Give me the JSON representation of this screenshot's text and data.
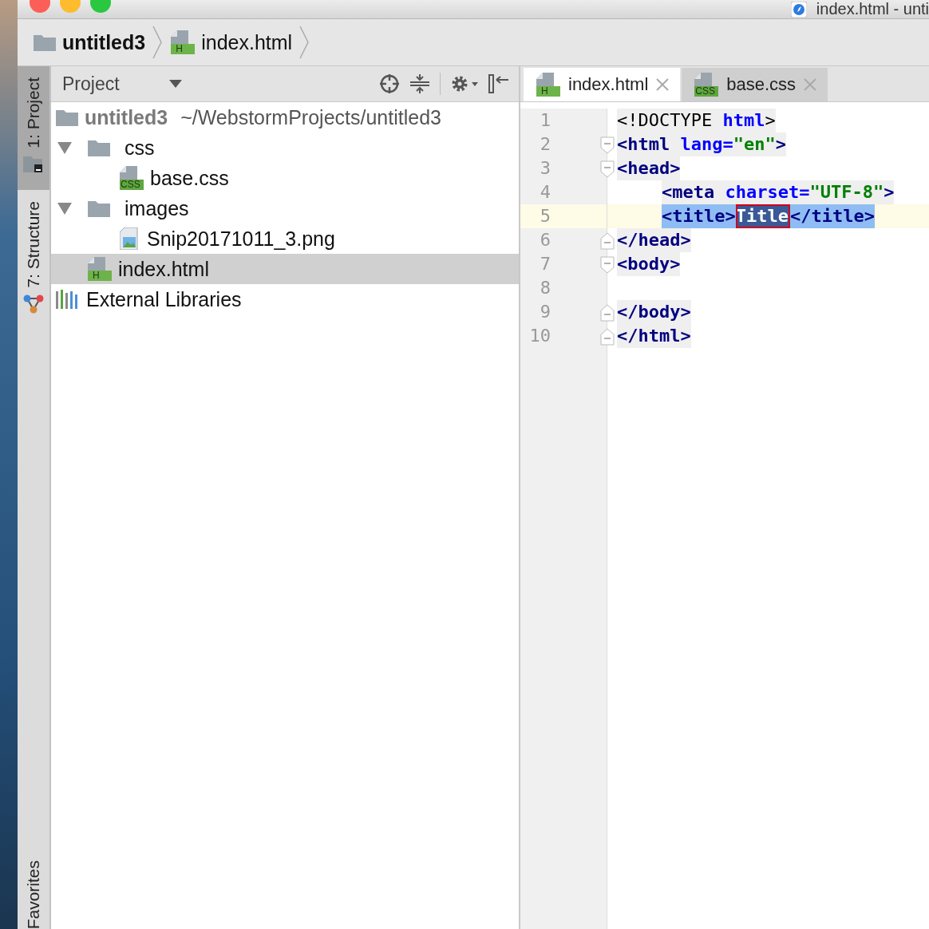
{
  "window": {
    "title": "index.html - unti"
  },
  "breadcrumbs": [
    {
      "label": "untitled3",
      "kind": "folder"
    },
    {
      "label": "index.html",
      "kind": "html",
      "badge": "H"
    }
  ],
  "tool_strip": [
    {
      "label": "1: Project",
      "kind": "project",
      "selected": true
    },
    {
      "label": "7: Structure",
      "kind": "structure",
      "selected": false
    },
    {
      "label": "Favorites",
      "kind": "favorites",
      "selected": false
    }
  ],
  "project_panel": {
    "title": "Project",
    "tree": [
      {
        "label": "untitled3",
        "path": "~/WebstormProjects/untitled3",
        "kind": "root",
        "selected": false,
        "children": [
          {
            "label": "css",
            "kind": "folder",
            "expanded": true,
            "selected": false,
            "children": [
              {
                "label": "base.css",
                "kind": "css",
                "badge": "CSS",
                "selected": false
              }
            ]
          },
          {
            "label": "images",
            "kind": "folder",
            "expanded": true,
            "selected": false,
            "children": [
              {
                "label": "Snip20171011_3.png",
                "kind": "image",
                "selected": false
              }
            ]
          },
          {
            "label": "index.html",
            "kind": "html",
            "badge": "H",
            "selected": true
          }
        ]
      },
      {
        "label": "External Libraries",
        "kind": "library",
        "selected": false
      }
    ]
  },
  "editor": {
    "tabs": [
      {
        "label": "index.html",
        "kind": "html",
        "badge": "H",
        "selected": true
      },
      {
        "label": "base.css",
        "kind": "css",
        "badge": "CSS",
        "selected": false
      }
    ],
    "lines": [
      {
        "number": "1",
        "current": false,
        "indented": false,
        "selected": false,
        "fold_start": false,
        "fold_end": false,
        "tokens": [
          {
            "text": "<!DOCTYPE ",
            "kind": "plain"
          },
          {
            "text": "html",
            "kind": "attr"
          },
          {
            "text": ">",
            "kind": "plain"
          }
        ]
      },
      {
        "number": "2",
        "current": false,
        "indented": false,
        "selected": false,
        "fold_start": true,
        "fold_end": false,
        "tokens": [
          {
            "text": "<html",
            "kind": "tag"
          },
          {
            "text": " lang=",
            "kind": "attr"
          },
          {
            "text": "\"en\"",
            "kind": "value"
          },
          {
            "text": ">",
            "kind": "tag"
          }
        ]
      },
      {
        "number": "3",
        "current": false,
        "indented": false,
        "selected": false,
        "fold_start": true,
        "fold_end": false,
        "tokens": [
          {
            "text": "<head>",
            "kind": "tag"
          }
        ]
      },
      {
        "number": "4",
        "current": false,
        "indented": true,
        "selected": false,
        "fold_start": false,
        "fold_end": false,
        "tokens": [
          {
            "text": "<meta",
            "kind": "tag"
          },
          {
            "text": " charset=",
            "kind": "attr"
          },
          {
            "text": "\"UTF-8\"",
            "kind": "value"
          },
          {
            "text": ">",
            "kind": "tag"
          }
        ]
      },
      {
        "number": "5",
        "current": true,
        "indented": true,
        "selected": true,
        "fold_start": false,
        "fold_end": false,
        "tokens": [
          {
            "text": "<title>",
            "kind": "tag"
          },
          {
            "text": "Title",
            "kind": "selected"
          },
          {
            "text": "</title>",
            "kind": "tag"
          }
        ]
      },
      {
        "number": "6",
        "current": false,
        "indented": false,
        "selected": false,
        "fold_start": false,
        "fold_end": true,
        "tokens": [
          {
            "text": "</head>",
            "kind": "tag"
          }
        ]
      },
      {
        "number": "7",
        "current": false,
        "indented": false,
        "selected": false,
        "fold_start": true,
        "fold_end": false,
        "tokens": [
          {
            "text": "<body>",
            "kind": "tag"
          }
        ]
      },
      {
        "number": "8",
        "current": false,
        "fold_start": false,
        "fold_end": false
      },
      {
        "number": "9",
        "current": false,
        "indented": false,
        "selected": false,
        "fold_start": false,
        "fold_end": true,
        "tokens": [
          {
            "text": "</body>",
            "kind": "tag"
          }
        ]
      },
      {
        "number": "10",
        "current": false,
        "indented": false,
        "selected": false,
        "fold_start": false,
        "fold_end": true,
        "tokens": [
          {
            "text": "</html>",
            "kind": "tag"
          }
        ]
      }
    ]
  }
}
